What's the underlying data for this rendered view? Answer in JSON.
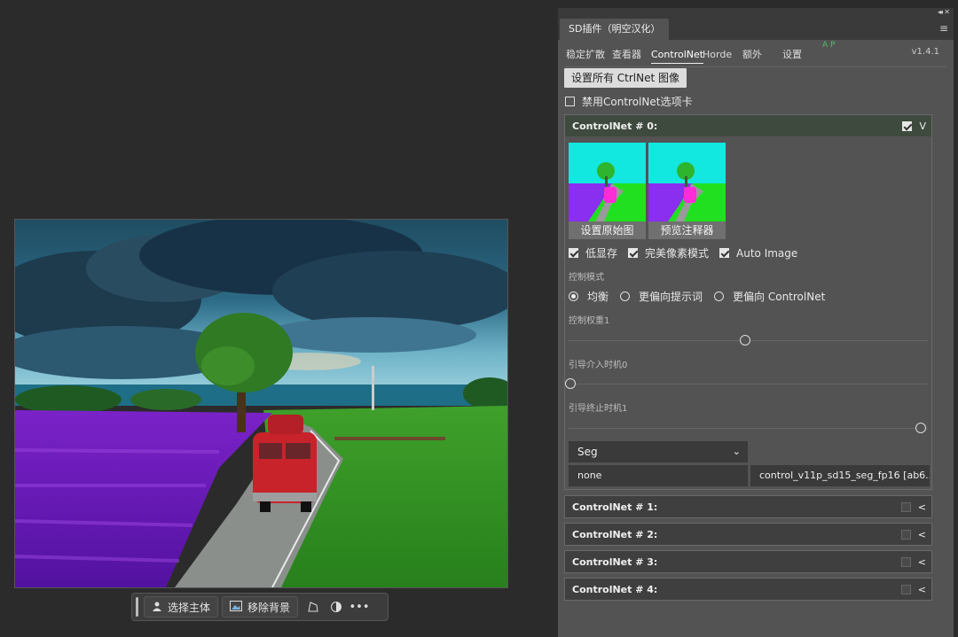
{
  "toolbar": {
    "select_subject": "选择主体",
    "remove_background": "移除背景",
    "icons": [
      "person-icon",
      "image-icon",
      "transform-icon",
      "adjust-icon",
      "more-icon"
    ]
  },
  "panel": {
    "title": "SD插件（明空汉化）",
    "tabs": [
      "稳定扩散",
      "查看器",
      "ControlNet",
      "Horde",
      "额外",
      "设置"
    ],
    "active_tab": "ControlNet",
    "ap_badge": "A P",
    "version": "v1.4.1",
    "set_all_button": "设置所有 CtrlNet 图像",
    "disable_tab_label": "禁用ControlNet选项卡",
    "controlnet0": {
      "title": "ControlNet # 0:",
      "enabled": true,
      "toggle": "V",
      "set_original_btn": "设置原始图",
      "preview_annotator_btn": "预览注释器",
      "low_vram": "低显存",
      "pixel_perfect": "完美像素模式",
      "auto_image": "Auto Image",
      "control_mode_label": "控制模式",
      "control_modes": [
        "均衡",
        "更偏向提示词",
        "更偏向 ControlNet"
      ],
      "control_mode_selected": 0,
      "weight_label": "控制权重1",
      "weight_value": 1,
      "guidance_start_label": "引导介入时机0",
      "guidance_start_value": 0,
      "guidance_end_label": "引导终止时机1",
      "guidance_end_value": 1,
      "preprocessor_dropdown": "Seg",
      "preprocessor": "none",
      "model": "control_v11p_sd15_seg_fp16 [ab6..."
    },
    "collapsed_units": [
      {
        "title": "ControlNet # 1:",
        "toggle": "<"
      },
      {
        "title": "ControlNet # 2:",
        "toggle": "<"
      },
      {
        "title": "ControlNet # 3:",
        "toggle": "<"
      },
      {
        "title": "ControlNet # 4:",
        "toggle": "<"
      }
    ]
  },
  "colors": {
    "background": "#2b2b2b",
    "panel": "#535353",
    "header_active": "#3e4a3e",
    "ap_green": "#4fbf67"
  }
}
